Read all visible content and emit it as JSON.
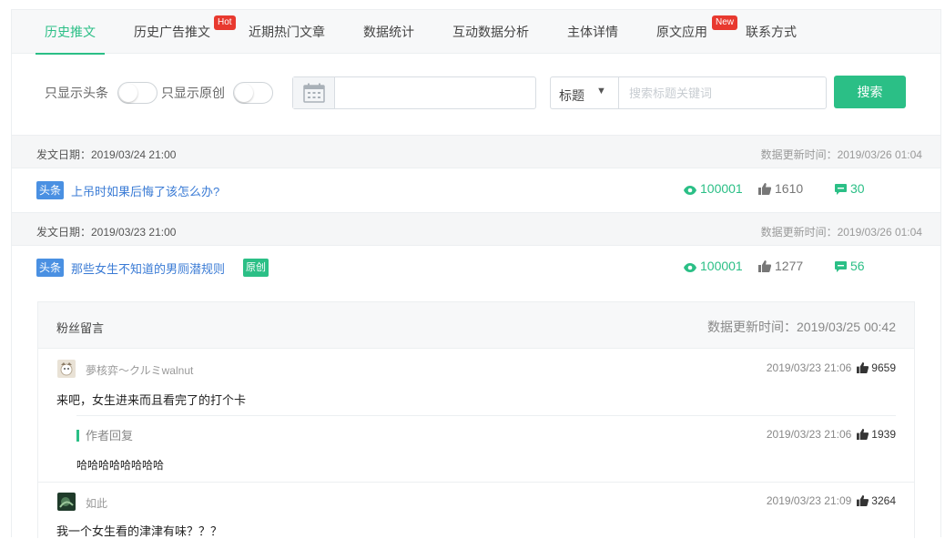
{
  "tabs": [
    {
      "label": "历史推文",
      "active": true
    },
    {
      "label": "历史广告推文",
      "badge": "Hot"
    },
    {
      "label": "近期热门文章"
    },
    {
      "label": "数据统计"
    },
    {
      "label": "互动数据分析"
    },
    {
      "label": "主体详情"
    },
    {
      "label": "原文应用",
      "badge": "New"
    },
    {
      "label": "联系方式"
    }
  ],
  "filters": {
    "only_headline_label": "只显示头条",
    "only_original_label": "只显示原创",
    "field_select_value": "标题",
    "search_placeholder": "搜索标题关键词",
    "search_button_label": "搜索"
  },
  "articles": [
    {
      "publish_label": "发文日期：2019/03/24 21:00",
      "update_label": "数据更新时间：2019/03/26 01:04",
      "tag": "头条",
      "title": "上吊时如果后悔了该怎么办?",
      "reads": "100001",
      "likes": "1610",
      "comments": "30"
    },
    {
      "publish_label": "发文日期：2019/03/23 21:00",
      "update_label": "数据更新时间：2019/03/26 01:04",
      "tag": "头条",
      "title": "那些女生不知道的男厕潜规则",
      "original_tag": "原创",
      "reads": "100001",
      "likes": "1277",
      "comments": "56"
    }
  ],
  "comments_panel": {
    "title": "粉丝留言",
    "update_label": "数据更新时间：2019/03/25 00:42",
    "items": [
      {
        "user": "夢核弈～クルミwalnut",
        "time": "2019/03/23 21:06",
        "likes": "9659",
        "text": "来吧，女生进来而且看完了的打个卡",
        "reply": {
          "label": "作者回复",
          "time": "2019/03/23 21:06",
          "likes": "1939",
          "text": "哈哈哈哈哈哈哈哈"
        }
      },
      {
        "user": "如此",
        "time": "2019/03/23 21:09",
        "likes": "3264",
        "text": "我一个女生看的津津有味？？？"
      }
    ]
  },
  "colors": {
    "accent": "#2bbf86",
    "link": "#3a7bd5",
    "headline_tag": "#4a90e2",
    "badge": "#e8392f"
  },
  "icons": {
    "calendar": "calendar-icon",
    "dropdown": "caret-down-icon",
    "reads": "eye-icon",
    "likes": "thumbs-up-icon",
    "comments": "comment-icon"
  }
}
